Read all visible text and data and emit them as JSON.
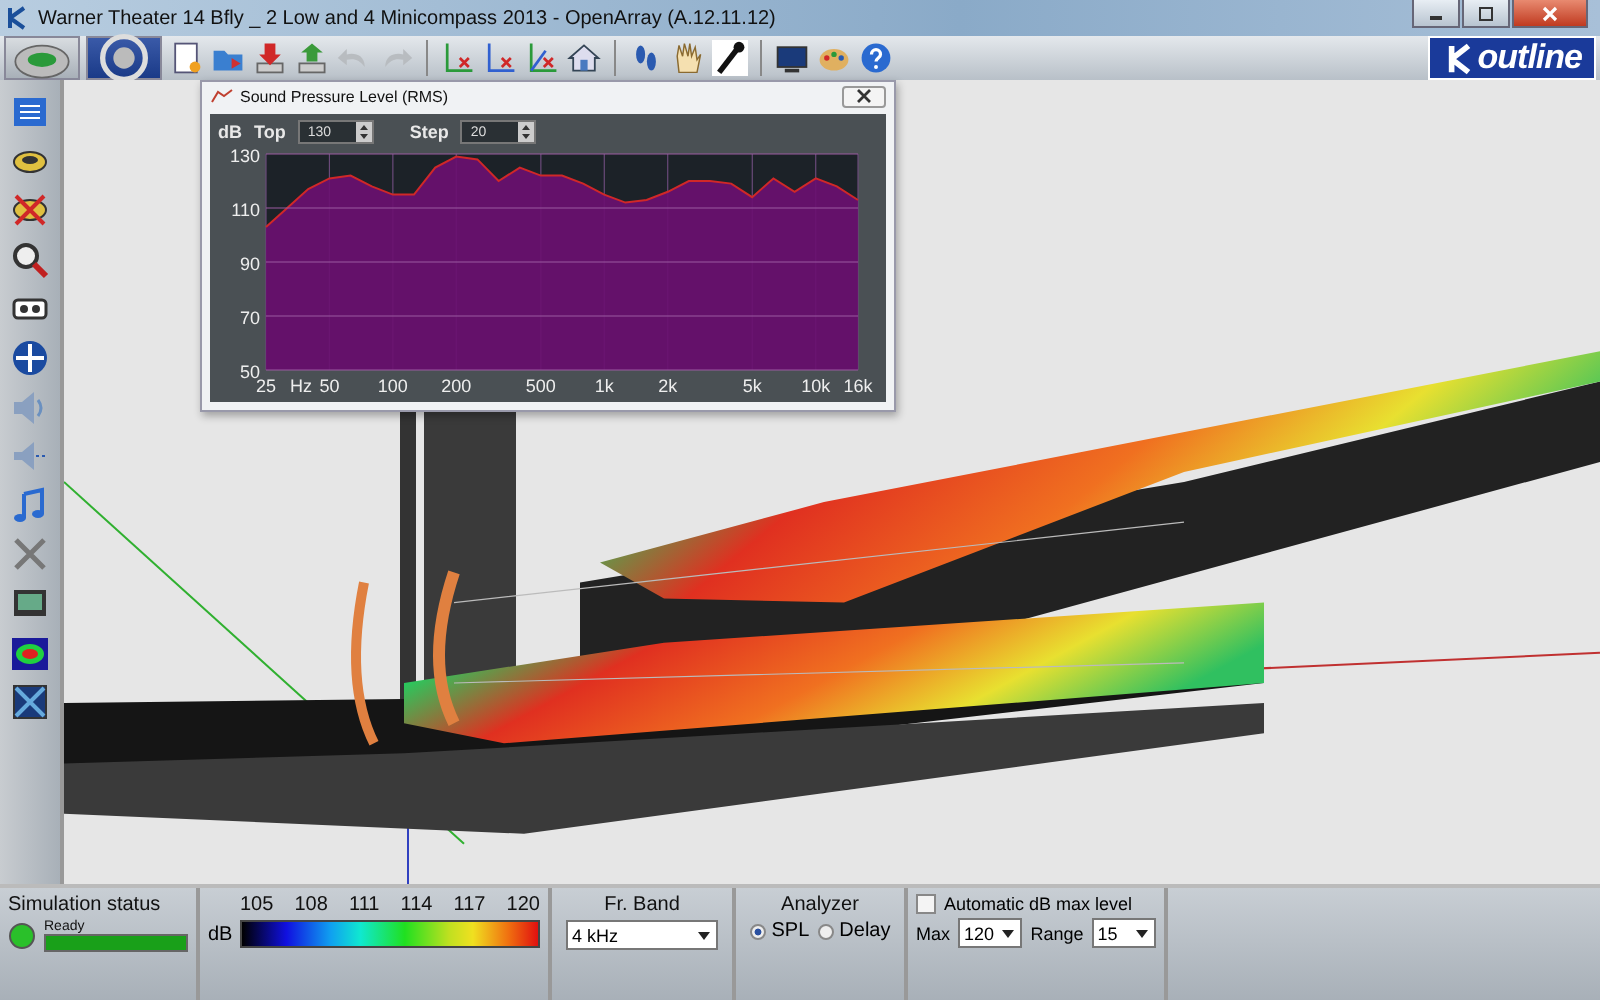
{
  "window": {
    "title": "Warner Theater 14 Bfly _ 2 Low and 4 Minicompass 2013 - OpenArray (A.12.11.12)"
  },
  "toolbar": {
    "undo": {
      "disabled": true
    },
    "redo": {
      "disabled": true
    }
  },
  "logo": {
    "text": "outline"
  },
  "spl_panel": {
    "title": "Sound Pressure Level (RMS)",
    "unit": "dB",
    "top_label": "Top",
    "top_value": "130",
    "step_label": "Step",
    "step_value": "20",
    "x_unit": "Hz",
    "chart_data": {
      "type": "area",
      "categories": [
        "25",
        null,
        null,
        "50",
        null,
        null,
        "100",
        null,
        null,
        "200",
        null,
        null,
        null,
        "500",
        null,
        null,
        "1k",
        null,
        null,
        "2k",
        null,
        null,
        null,
        "5k",
        null,
        null,
        "10k",
        null,
        "16k"
      ],
      "series": [
        {
          "color": "#6a1070",
          "values": [
            103,
            110,
            117,
            121,
            122,
            118,
            115,
            115,
            125,
            129,
            128,
            120,
            125,
            122,
            122,
            119,
            115,
            112,
            113,
            116,
            120,
            120,
            119,
            114,
            121,
            116,
            121,
            118,
            113
          ]
        }
      ],
      "ylim": [
        50,
        130
      ],
      "yticks": [
        50,
        70,
        90,
        110,
        130
      ],
      "grid": true
    }
  },
  "status_bar": {
    "simulation": {
      "label": "Simulation status",
      "state": "Ready",
      "level": 1.0
    },
    "scale": {
      "unit": "dB",
      "ticks": [
        "105",
        "108",
        "111",
        "114",
        "117",
        "120"
      ]
    },
    "band": {
      "label": "Fr. Band",
      "value": "4 kHz"
    },
    "analyzer": {
      "label": "Analyzer",
      "options": [
        {
          "label": "SPL",
          "selected": true
        },
        {
          "label": "Delay",
          "selected": false
        }
      ]
    },
    "auto_level": {
      "label": "Automatic dB max level",
      "checked": false,
      "max_label": "Max",
      "max_value": "120",
      "range_label": "Range",
      "range_value": "15"
    }
  }
}
